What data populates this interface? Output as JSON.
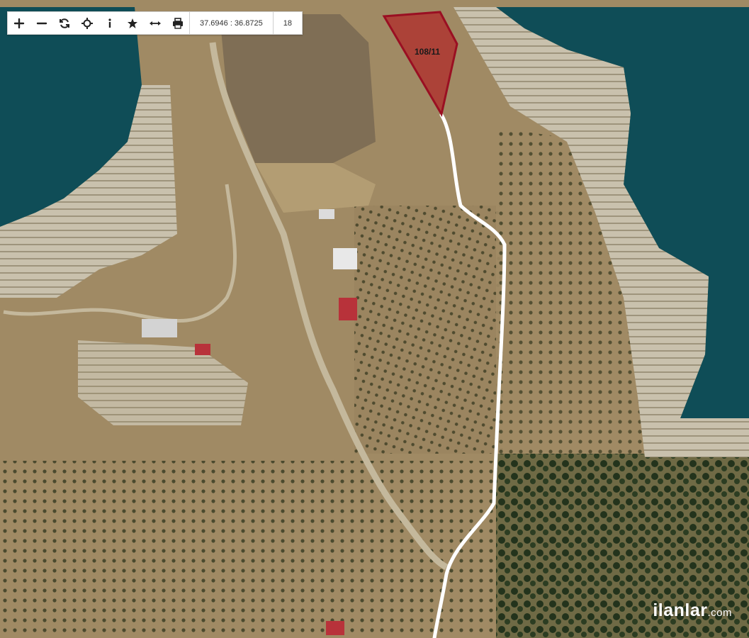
{
  "toolbar": {
    "tools": [
      {
        "name": "zoom-in-button",
        "icon": "plus-icon"
      },
      {
        "name": "zoom-out-button",
        "icon": "minus-icon"
      },
      {
        "name": "refresh-button",
        "icon": "refresh-icon"
      },
      {
        "name": "locate-button",
        "icon": "crosshair-icon"
      },
      {
        "name": "info-button",
        "icon": "info-icon"
      },
      {
        "name": "favorite-button",
        "icon": "star-icon"
      },
      {
        "name": "measure-button",
        "icon": "measure-arrows-icon"
      },
      {
        "name": "print-button",
        "icon": "print-icon"
      }
    ],
    "coordinates": "37.6946 : 36.8725",
    "zoom": "18"
  },
  "map": {
    "parcel_label": "108/11",
    "parcel_fill": "#b02a2a",
    "parcel_stroke": "#9a0f22",
    "road_color": "#ffffff",
    "water_color": "#0f4d57",
    "land_color": "#a08a64"
  },
  "watermark": {
    "brand": "ilanlar",
    "domain": ".com"
  }
}
